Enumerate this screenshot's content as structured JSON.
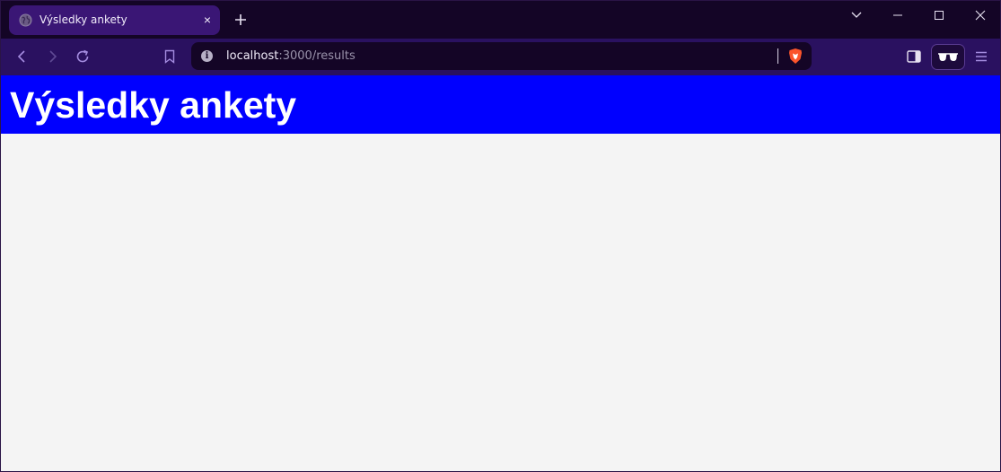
{
  "browser": {
    "tab": {
      "title": "Výsledky ankety",
      "close_glyph": "×"
    },
    "url": {
      "host": "localhost",
      "path": ":3000/results"
    },
    "icons": {
      "favicon": "globe-icon",
      "new_tab": "plus-icon",
      "back": "chevron-left-icon",
      "forward": "chevron-right-icon",
      "reload": "reload-icon",
      "bookmark": "bookmark-icon",
      "site_info": "info-icon",
      "shields": "brave-shield-icon",
      "sidebar": "sidebar-icon",
      "wallet": "glasses-icon",
      "menu": "hamburger-menu-icon"
    },
    "colors": {
      "tabstrip": "#140526",
      "toolbar": "#2a1160",
      "active_tab": "#3a1675",
      "shield": "#fb542b"
    }
  },
  "page": {
    "title": "Výsledky ankety",
    "colors": {
      "header_background": "#0000ff",
      "header_text": "#ffffff",
      "body_background": "#f4f4f4"
    }
  }
}
